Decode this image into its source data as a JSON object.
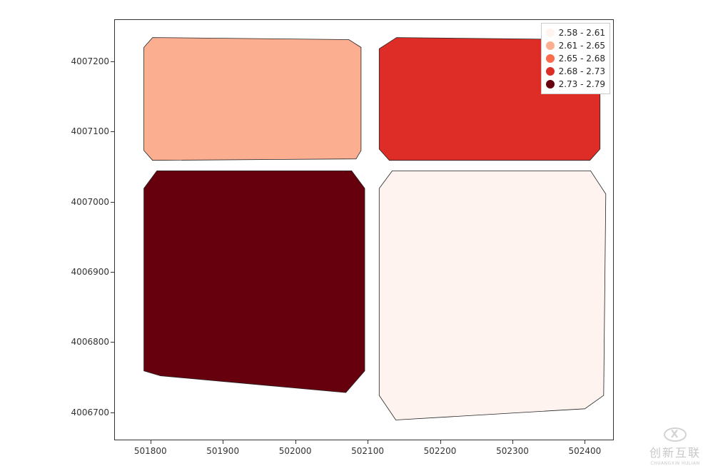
{
  "chart_data": {
    "type": "choropleth",
    "x_ticks": [
      501800,
      501900,
      502000,
      502100,
      502200,
      502300,
      502400
    ],
    "y_ticks": [
      4006700,
      4006800,
      4006900,
      4007000,
      4007100,
      4007200
    ],
    "xlim": [
      501750,
      502440
    ],
    "ylim": [
      4006660,
      4007260
    ],
    "regions": [
      {
        "name": "top-left",
        "value_bin": "2.61 - 2.65",
        "color": "#fcae91",
        "approx_bbox_x": [
          501790,
          502090
        ],
        "approx_bbox_y": [
          4007060,
          4007235
        ]
      },
      {
        "name": "top-right",
        "value_bin": "2.68 - 2.73",
        "color": "#de2d26",
        "approx_bbox_x": [
          502115,
          502420
        ],
        "approx_bbox_y": [
          4007060,
          4007235
        ]
      },
      {
        "name": "bottom-left",
        "value_bin": "2.73 - 2.79",
        "color": "#67000d",
        "approx_bbox_x": [
          501790,
          502095
        ],
        "approx_bbox_y": [
          4006735,
          4007045
        ]
      },
      {
        "name": "bottom-right",
        "value_bin": "2.58 - 2.61",
        "color": "#fff3ef",
        "approx_bbox_x": [
          502115,
          502425
        ],
        "approx_bbox_y": [
          4006700,
          4007045
        ]
      }
    ],
    "legend": {
      "position": "upper right",
      "entries": [
        {
          "label": "2.58 - 2.61",
          "color": "#fff3ef"
        },
        {
          "label": "2.61 - 2.65",
          "color": "#fcae91"
        },
        {
          "label": "2.65 - 2.68",
          "color": "#fb6a4a"
        },
        {
          "label": "2.68 - 2.73",
          "color": "#de2d26"
        },
        {
          "label": "2.73 - 2.79",
          "color": "#67000d"
        }
      ]
    },
    "title": "",
    "xlabel": "",
    "ylabel": ""
  },
  "watermark": {
    "brand": "创新互联",
    "sub": "CHUANGXIN HULIAN"
  }
}
